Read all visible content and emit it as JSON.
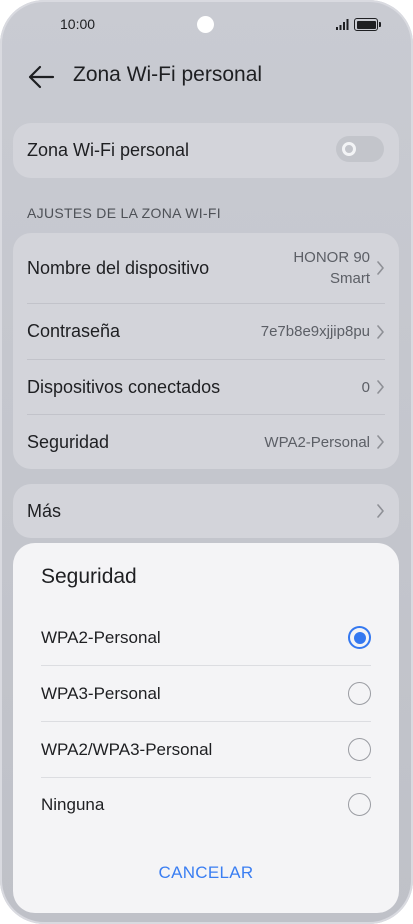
{
  "status_bar": {
    "time": "10:00"
  },
  "header": {
    "title": "Zona Wi-Fi personal"
  },
  "hotspot_toggle": {
    "label": "Zona Wi-Fi personal",
    "enabled": false
  },
  "settings_section": {
    "title": "AJUSTES DE LA ZONA WI-FI",
    "items": [
      {
        "label": "Nombre del dispositivo",
        "value_line1": "HONOR 90",
        "value_line2": "Smart"
      },
      {
        "label": "Contraseña",
        "value": "7e7b8e9xjjip8pu"
      },
      {
        "label": "Dispositivos conectados",
        "value": "0"
      },
      {
        "label": "Seguridad",
        "value": "WPA2-Personal"
      }
    ]
  },
  "more": {
    "label": "Más"
  },
  "dialog": {
    "title": "Seguridad",
    "options": [
      {
        "label": "WPA2-Personal",
        "selected": true
      },
      {
        "label": "WPA3-Personal",
        "selected": false
      },
      {
        "label": "WPA2/WPA3-Personal",
        "selected": false
      },
      {
        "label": "Ninguna",
        "selected": false
      }
    ],
    "cancel_label": "CANCELAR"
  },
  "colors": {
    "accent": "#3478f0",
    "background": "#c9cbd2",
    "card": "#d3d4da",
    "dialog": "#f4f4f6"
  },
  "icons": [
    "back-arrow-icon",
    "signal-icon",
    "battery-icon",
    "chevron-right-icon",
    "toggle-switch",
    "radio-button"
  ]
}
